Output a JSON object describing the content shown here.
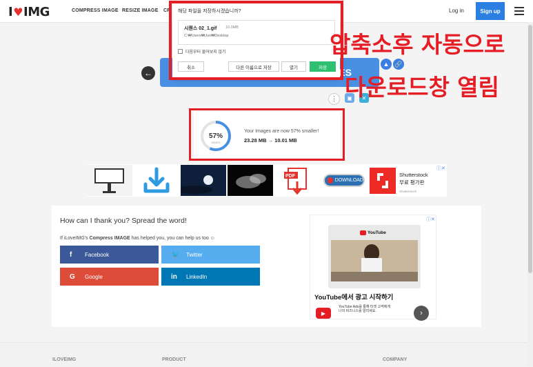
{
  "header": {
    "logo_left": "I",
    "logo_right": "IMG",
    "nav": [
      "COMPRESS IMAGE",
      "RESIZE IMAGE",
      "CR"
    ],
    "login": "Log in",
    "signup": "Sign up"
  },
  "main": {
    "download_label": "ES",
    "savings": {
      "percent": "57%",
      "saved_label": "SAVED",
      "percent_value": 57,
      "message": "Your Images are now 57% smaller!",
      "sizes": "23.28 MB → 10.01 MB"
    }
  },
  "ads": {
    "shutterstock_name": "Shutterstock",
    "shutterstock_sub": "무료 평가판",
    "shutterstock_small": "Shutterstock",
    "download_badge": "DOWNLOAD",
    "pdf_label": "PDF"
  },
  "share": {
    "title": "How can I thank you? Spread the word!",
    "sub_pre": "If iLoveIMG's ",
    "sub_bold": "Compress IMAGE",
    "sub_post": " has helped you, you can help us too ☺",
    "buttons": {
      "facebook": "Facebook",
      "twitter": "Twitter",
      "google": "Google",
      "linkedin": "LinkedIn"
    },
    "youtube_ad": {
      "logo": "YouTube",
      "headline": "YouTube에서 광고 시작하기",
      "desc": "YouTube Ads를 통해 타겟 고객에게 나의 비즈니스를 알리세요."
    }
  },
  "footer": {
    "cols": [
      "ILOVEIMG",
      "PRODUCT",
      "COMPANY"
    ]
  },
  "dialog": {
    "question": "해당 파일을 저장하시겠습니까?",
    "file_name": "시퀀스 02_1.gif",
    "file_size": "10.0MB",
    "file_path": "C:₩Users₩Jun₩Desktop",
    "dont_ask": "다음부터 물어보지 않기",
    "cancel": "취소",
    "save_as": "다른 이름으로 저장",
    "open": "열기",
    "save": "저장"
  },
  "annotation": {
    "line1": "압축소후 자동으로",
    "line2": "다운로드창 열림"
  },
  "colors": {
    "accent": "#4a90e2",
    "brand_red": "#e5322d",
    "annotation_red": "#e51d24",
    "facebook": "#3b5998",
    "twitter": "#55acee",
    "google": "#dd4b39",
    "linkedin": "#0077b5",
    "save_green": "#2fbf71"
  }
}
